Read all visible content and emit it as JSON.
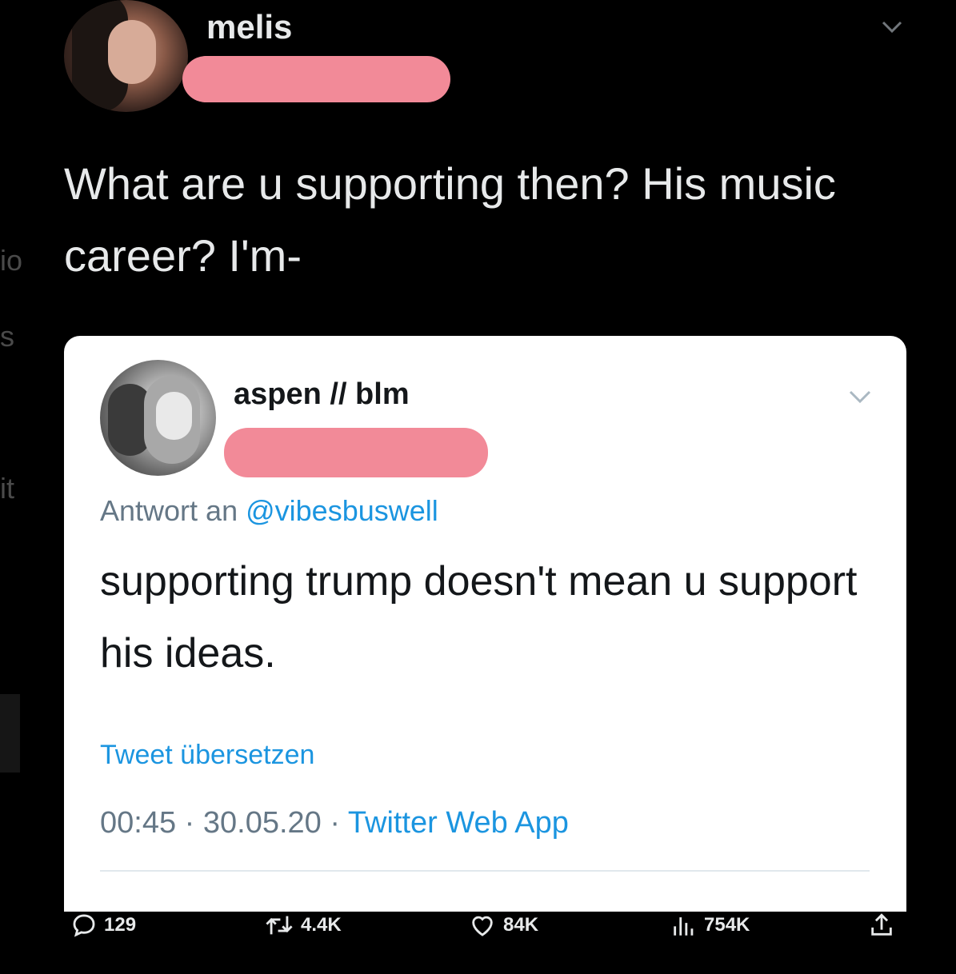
{
  "tweet": {
    "display_name": "melis",
    "text": "What are u supporting then? His music career? I'm-"
  },
  "quoted": {
    "display_name": "aspen // blm",
    "reply_prefix": "Antwort an",
    "reply_handle": "@vibesbuswell",
    "text": "supporting trump doesn't mean u support his ideas.",
    "translate": "Tweet übersetzen",
    "time": "00:45",
    "date": "30.05.20",
    "app": "Twitter Web App",
    "separator": " · "
  },
  "actions": {
    "replies": "129",
    "retweets": "4.4K",
    "likes": "84K",
    "views": "754K"
  },
  "colors": {
    "background": "#000000",
    "redaction": "#f28a98",
    "link": "#1b95e0"
  }
}
